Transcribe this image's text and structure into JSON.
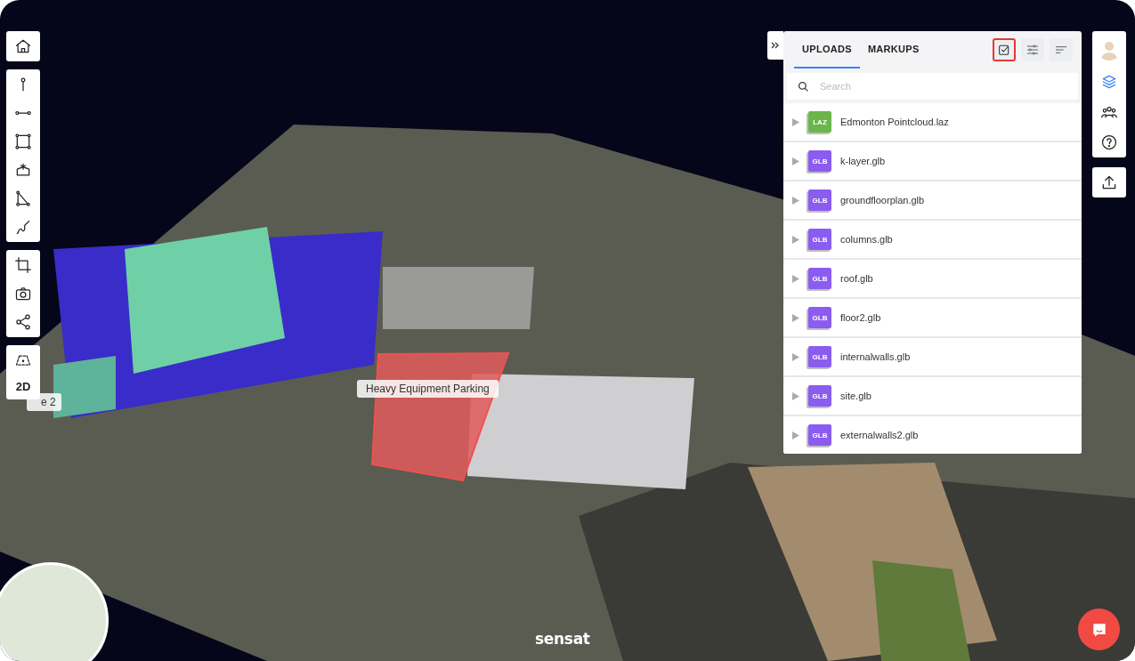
{
  "tabs": [
    {
      "label": "UPLOADS",
      "selected": true
    },
    {
      "label": "MARKUPS",
      "selected": false
    }
  ],
  "panel_actions": [
    {
      "kind": "select",
      "highlighted": true
    },
    {
      "kind": "filter",
      "highlighted": false
    },
    {
      "kind": "sort",
      "highlighted": false
    }
  ],
  "search": {
    "placeholder": "Search"
  },
  "uploads": [
    {
      "name": "Edmonton Pointcloud.laz",
      "badge": "LAZ",
      "color": "#6ab64a"
    },
    {
      "name": "k-layer.glb",
      "badge": "GLB",
      "color": "#8b5cf0"
    },
    {
      "name": "groundfloorplan.glb",
      "badge": "GLB",
      "color": "#8b5cf0"
    },
    {
      "name": "columns.glb",
      "badge": "GLB",
      "color": "#8b5cf0"
    },
    {
      "name": "roof.glb",
      "badge": "GLB",
      "color": "#8b5cf0"
    },
    {
      "name": "floor2.glb",
      "badge": "GLB",
      "color": "#8b5cf0"
    },
    {
      "name": "internalwalls.glb",
      "badge": "GLB",
      "color": "#8b5cf0"
    },
    {
      "name": "site.glb",
      "badge": "GLB",
      "color": "#8b5cf0"
    },
    {
      "name": "externalwalls2.glb",
      "badge": "GLB",
      "color": "#8b5cf0"
    }
  ],
  "right_tools": [
    {
      "kind": "layers",
      "selected": true
    },
    {
      "kind": "team",
      "selected": false
    },
    {
      "kind": "help",
      "selected": false
    }
  ],
  "view_mode": "2D",
  "markup_labels": [
    {
      "text": "Heavy Equipment Parking"
    },
    {
      "text": "e 2"
    }
  ],
  "logo": "sensat"
}
